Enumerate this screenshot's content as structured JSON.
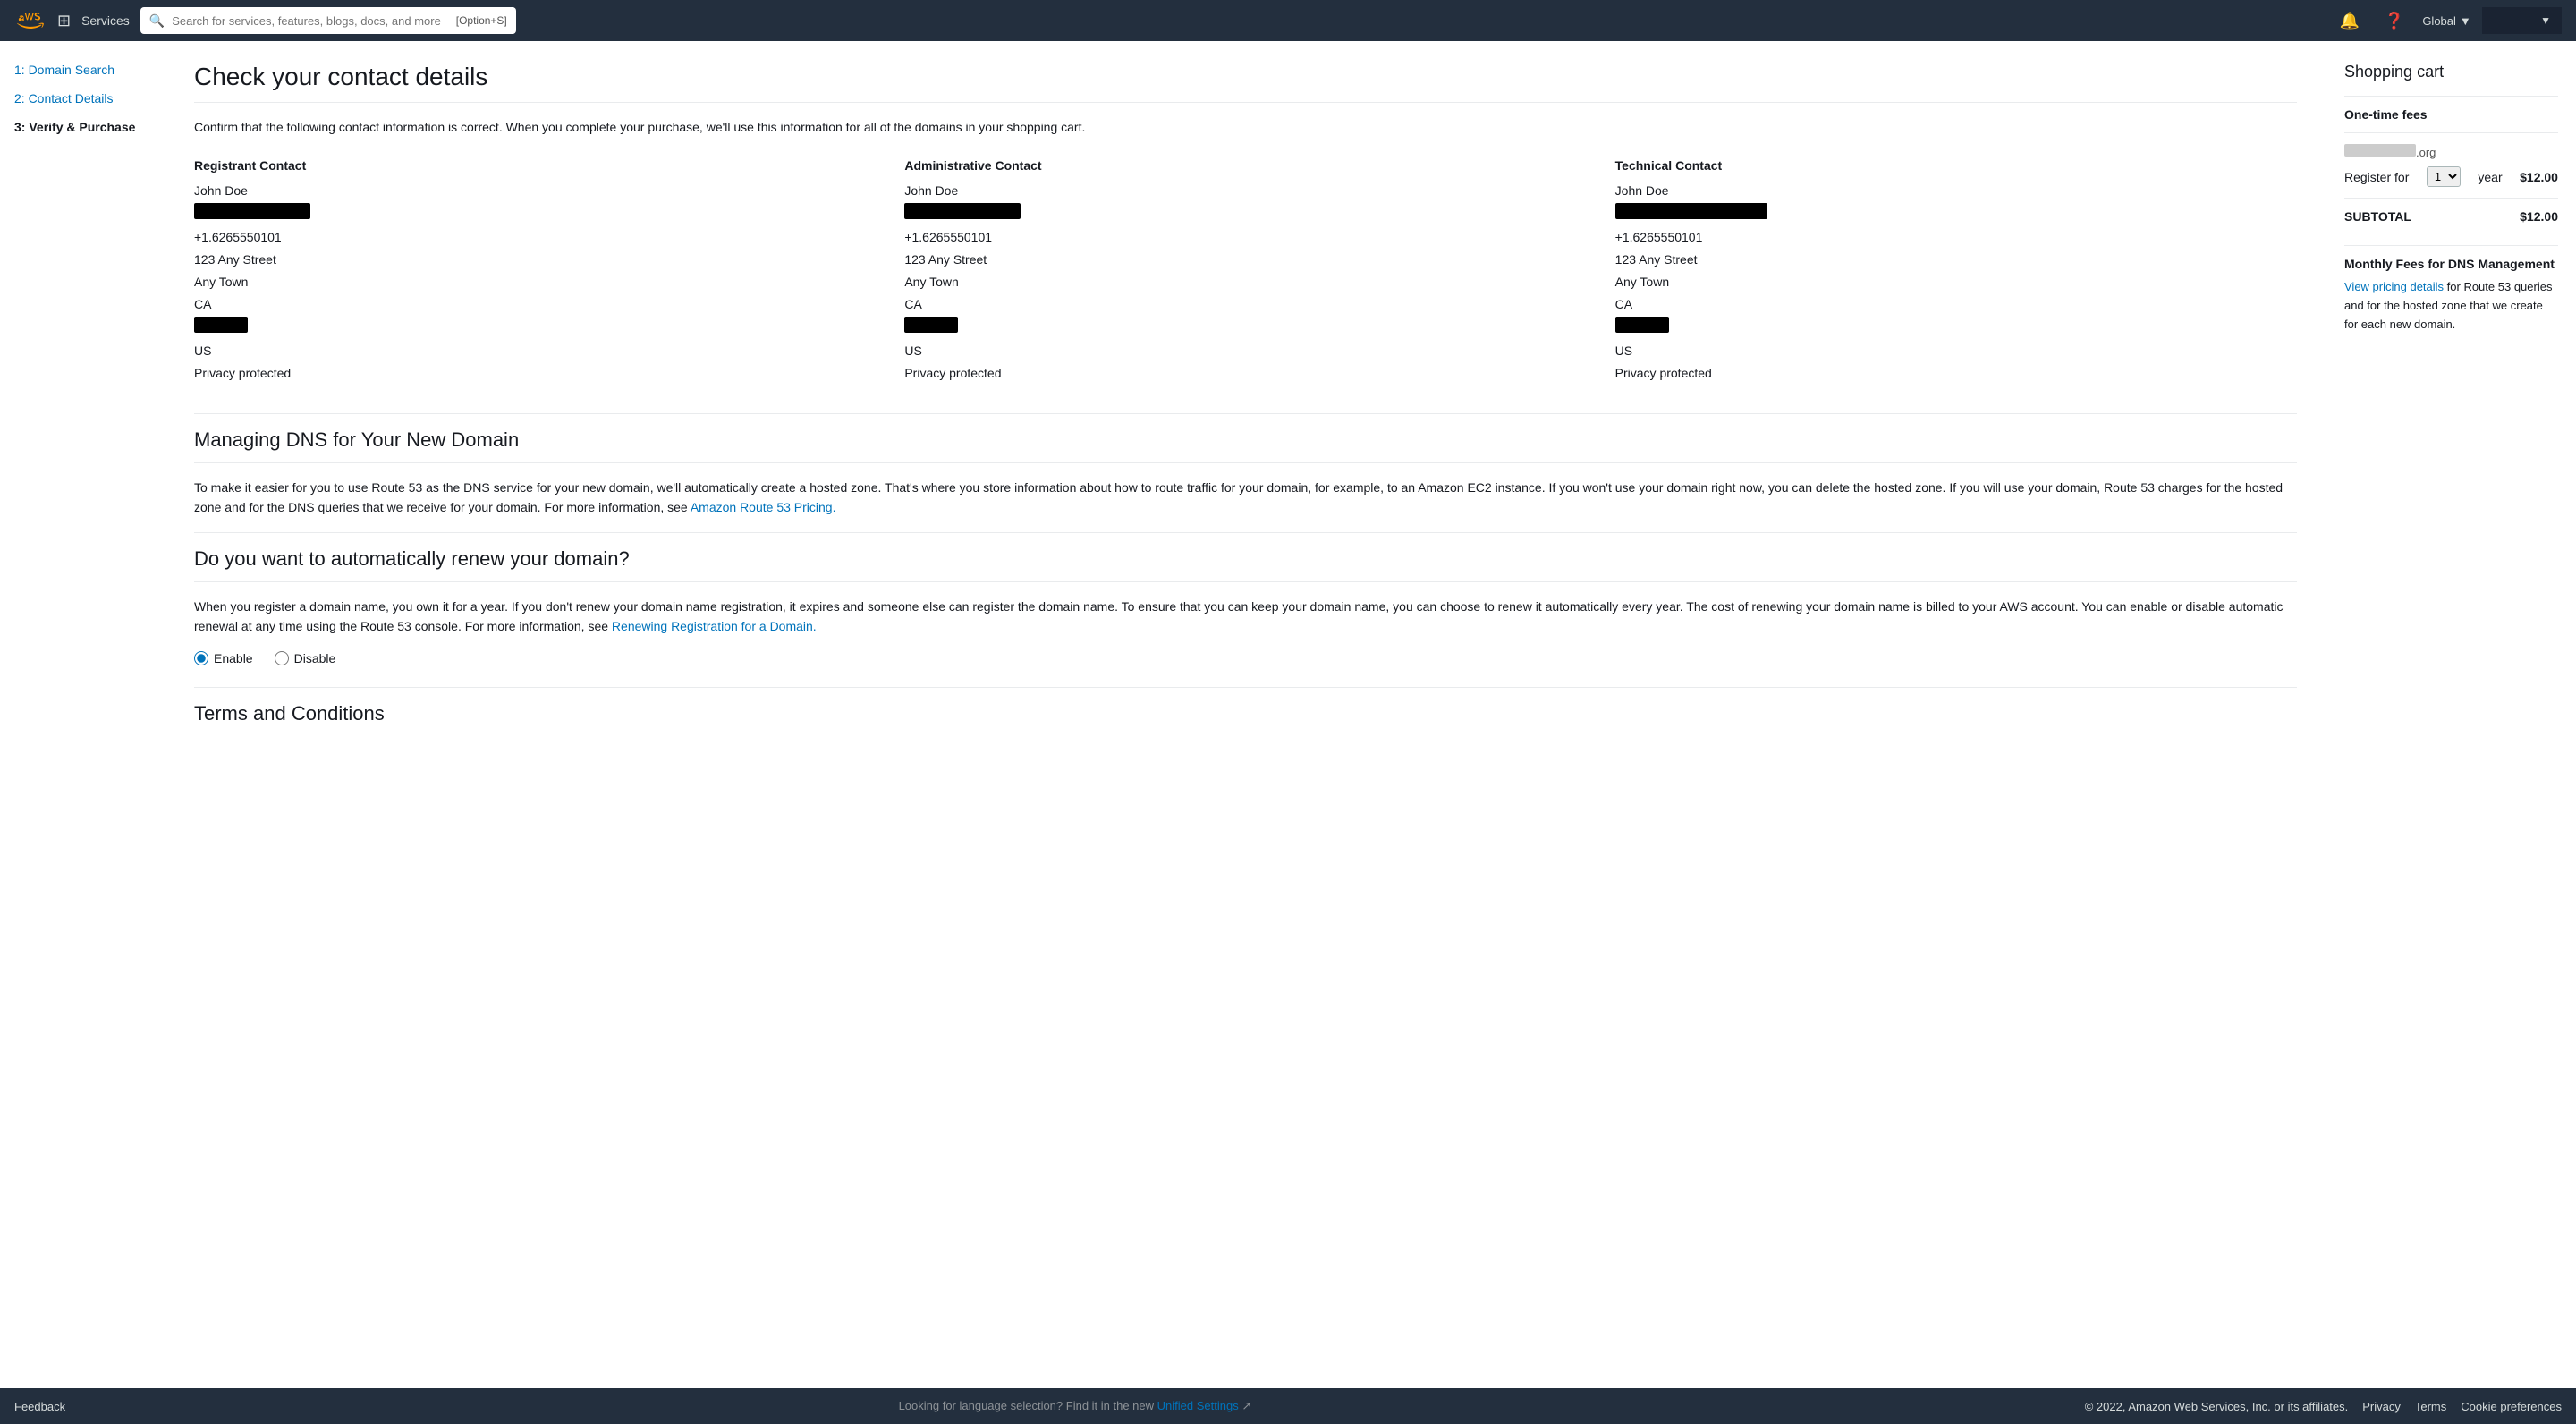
{
  "nav": {
    "services_label": "Services",
    "search_placeholder": "Search for services, features, blogs, docs, and more",
    "search_shortcut": "[Option+S]",
    "global_label": "Global",
    "account_label": "▼"
  },
  "sidebar": {
    "items": [
      {
        "id": "domain-search",
        "label": "1: Domain Search",
        "link": true
      },
      {
        "id": "contact-details",
        "label": "2: Contact Details",
        "link": true
      },
      {
        "id": "verify-purchase",
        "label": "3: Verify & Purchase",
        "link": false
      }
    ]
  },
  "main": {
    "page_title": "Check your contact details",
    "description": "Confirm that the following contact information is correct. When you complete your purchase, we'll use this information for all of the domains in your shopping cart.",
    "registrant_contact": {
      "heading": "Registrant Contact",
      "name": "John Doe",
      "phone": "+1.6265550101",
      "address1": "123 Any Street",
      "city": "Any Town",
      "state": "CA",
      "country": "US",
      "privacy": "Privacy protected"
    },
    "administrative_contact": {
      "heading": "Administrative Contact",
      "name": "John Doe",
      "phone": "+1.6265550101",
      "address1": "123 Any Street",
      "city": "Any Town",
      "state": "CA",
      "country": "US",
      "privacy": "Privacy protected"
    },
    "technical_contact": {
      "heading": "Technical Contact",
      "name": "John Doe",
      "phone": "+1.6265550101",
      "address1": "123 Any Street",
      "city": "Any Town",
      "state": "CA",
      "country": "US",
      "privacy": "Privacy protected"
    },
    "dns_section": {
      "heading": "Managing DNS for Your New Domain",
      "body": "To make it easier for you to use Route 53 as the DNS service for your new domain, we'll automatically create a hosted zone. That's where you store information about how to route traffic for your domain, for example, to an Amazon EC2 instance. If you won't use your domain right now, you can delete the hosted zone. If you will use your domain, Route 53 charges for the hosted zone and for the DNS queries that we receive for your domain. For more information, see ",
      "link_text": "Amazon Route 53 Pricing.",
      "link_url": "#"
    },
    "renewal_section": {
      "heading": "Do you want to automatically renew your domain?",
      "body": "When you register a domain name, you own it for a year. If you don't renew your domain name registration, it expires and someone else can register the domain name. To ensure that you can keep your domain name, you can choose to renew it automatically every year. The cost of renewing your domain name is billed to your AWS account. You can enable or disable automatic renewal at any time using the Route 53 console. For more information, see ",
      "link_text": "Renewing Registration for a Domain.",
      "link_url": "#",
      "enable_label": "Enable",
      "disable_label": "Disable"
    },
    "terms_heading": "Terms and Conditions"
  },
  "shopping_cart": {
    "title": "Shopping cart",
    "one_time_fees_label": "One-time fees",
    "domain_tld": ".org",
    "register_for_label": "Register for",
    "year_value": "1",
    "year_label": "year",
    "price": "$12.00",
    "subtotal_label": "SUBTOTAL",
    "subtotal_value": "$12.00",
    "monthly_fees_label": "Monthly Fees for DNS Management",
    "monthly_fees_text_prefix": "",
    "view_pricing_link": "View pricing details",
    "monthly_fees_text": " for Route 53 queries and for the hosted zone that we create for each new domain."
  },
  "footer": {
    "feedback_label": "Feedback",
    "middle_text": "Looking for language selection? Find it in the new ",
    "unified_settings_link": "Unified Settings",
    "copyright": "© 2022, Amazon Web Services, Inc. or its affiliates.",
    "privacy_label": "Privacy",
    "terms_label": "Terms",
    "cookie_label": "Cookie preferences"
  }
}
